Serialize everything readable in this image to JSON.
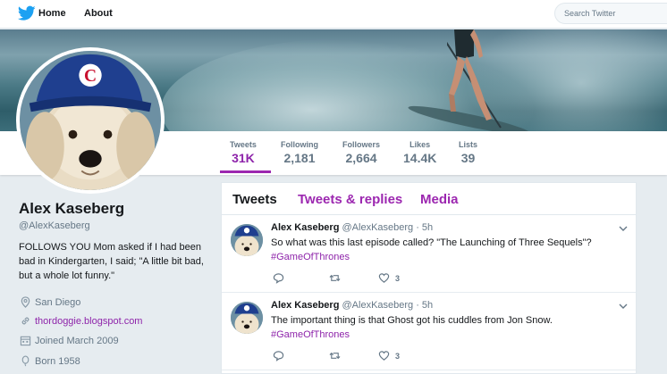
{
  "nav": {
    "home_label": "Home",
    "about_label": "About",
    "search_placeholder": "Search Twitter"
  },
  "stats": [
    {
      "label": "Tweets",
      "value": "31K",
      "active": true
    },
    {
      "label": "Following",
      "value": "2,181"
    },
    {
      "label": "Followers",
      "value": "2,664"
    },
    {
      "label": "Likes",
      "value": "14.4K"
    },
    {
      "label": "Lists",
      "value": "39"
    }
  ],
  "profile": {
    "name": "Alex Kaseberg",
    "handle": "@AlexKaseberg",
    "bio": "FOLLOWS YOU Mom asked if I had been bad in Kindergarten, I said; \"A little bit bad, but a whole lot funny.\"",
    "location": "San Diego",
    "website": "thordoggie.blogspot.com",
    "joined": "Joined March 2009",
    "born": "Born 1958"
  },
  "tabs": {
    "tweets": "Tweets",
    "replies": "Tweets & replies",
    "media": "Media"
  },
  "tweets": [
    {
      "name": "Alex Kaseberg",
      "meta": "@AlexKaseberg · 5h",
      "text": "So what was this last episode called? \"The Launching of Three Sequels\"?",
      "hashtag": "#GameOfThrones",
      "likes": "3"
    },
    {
      "name": "Alex Kaseberg",
      "meta": "@AlexKaseberg · 5h",
      "text": "The important thing is that Ghost got his cuddles from Jon Snow.",
      "hashtag": "#GameOfThrones",
      "likes": "3"
    }
  ],
  "colors": {
    "accent": "#9c27b0",
    "link": "#8e24aa",
    "twitter_blue": "#1da1f2"
  }
}
